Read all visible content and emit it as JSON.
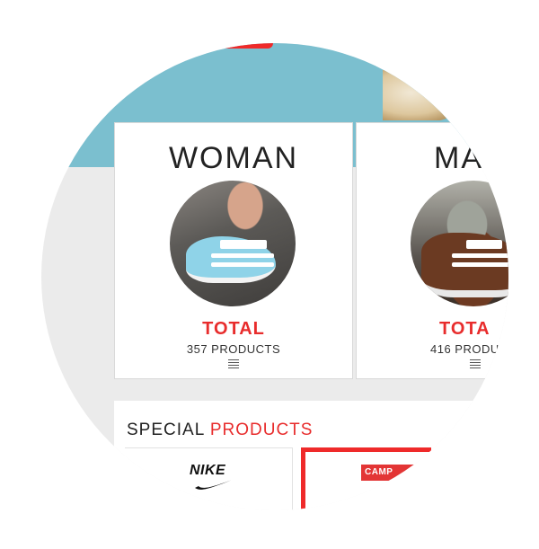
{
  "categories": [
    {
      "title": "WOMAN",
      "total_label": "TOTAL",
      "count": "357 PRODUCTS"
    },
    {
      "title": "MA",
      "total_label": "TOTA",
      "count": "416 PRODU"
    }
  ],
  "special": {
    "title_part1": "SPECIAL",
    "title_part2": "PRODUCTS"
  },
  "brands": [
    {
      "name": "NIKE",
      "icon": "nike-swoosh-logo"
    },
    {
      "name": "CAMP",
      "icon": "camper-logo"
    }
  ],
  "colors": {
    "accent": "#e82c2c",
    "header": "#7bbfcf",
    "background": "#ebebeb"
  }
}
